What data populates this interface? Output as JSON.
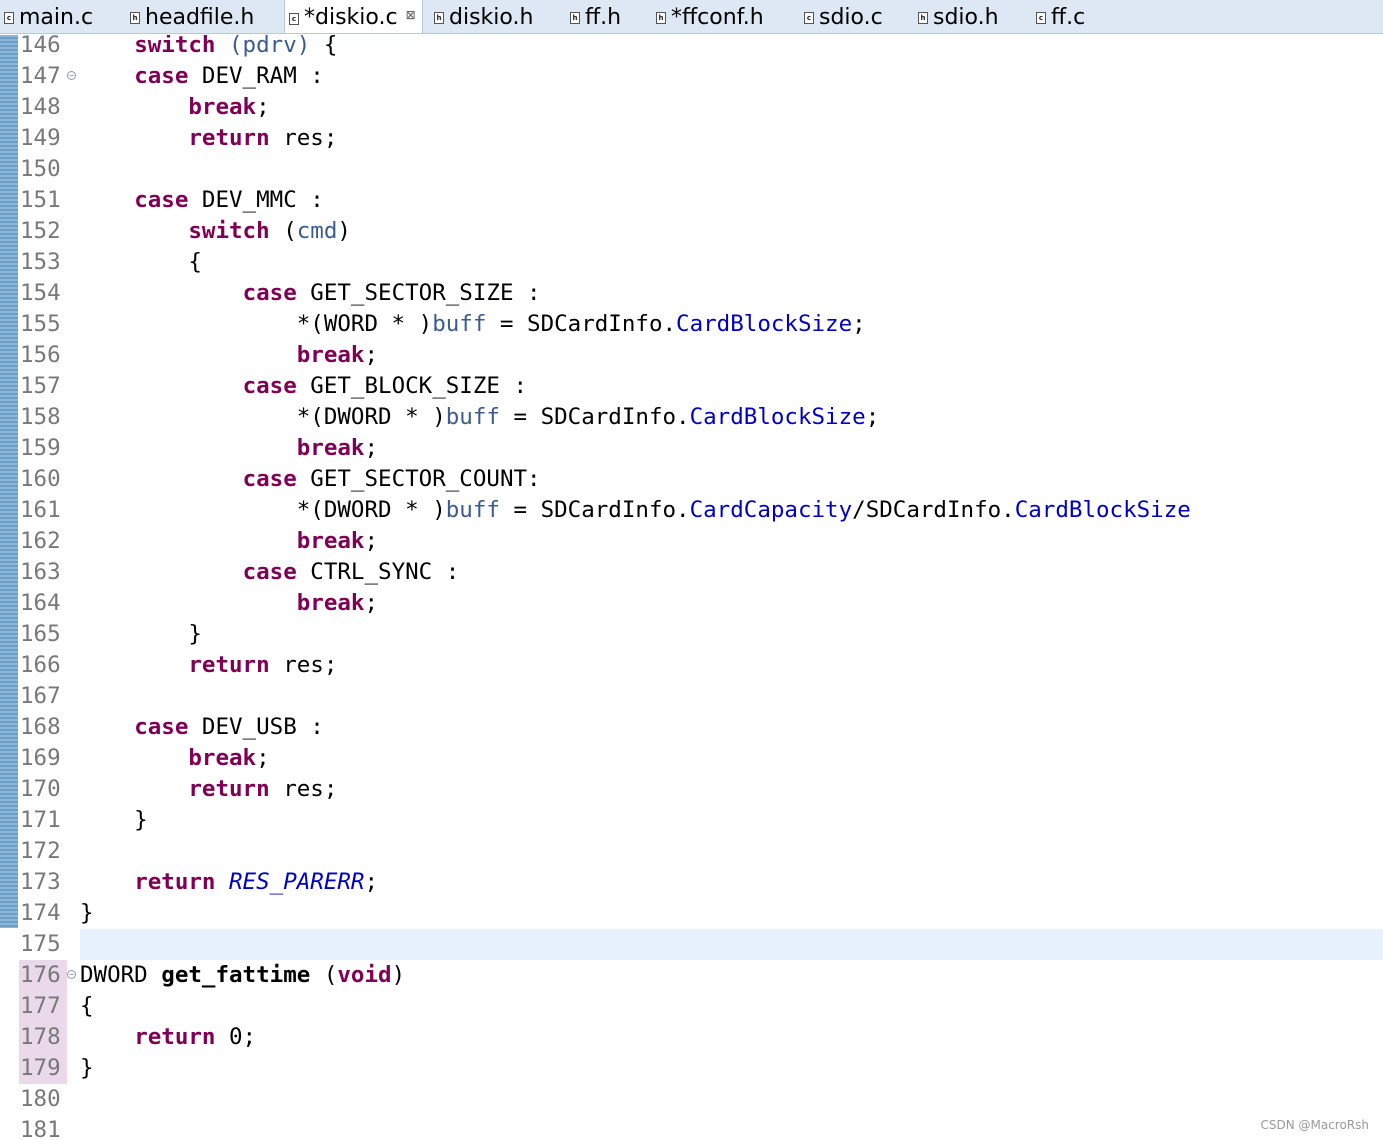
{
  "tabs": [
    {
      "label": "main.c",
      "icon": "c-file-icon",
      "active": false
    },
    {
      "label": "headfile.h",
      "icon": "h-file-icon",
      "active": false
    },
    {
      "label": "*diskio.c",
      "icon": "c-file-icon",
      "active": true,
      "close": "⊠"
    },
    {
      "label": "diskio.h",
      "icon": "h-file-icon",
      "active": false
    },
    {
      "label": "ff.h",
      "icon": "h-file-icon",
      "active": false
    },
    {
      "label": "*ffconf.h",
      "icon": "h-file-icon",
      "active": false
    },
    {
      "label": "sdio.c",
      "icon": "c-file-icon",
      "active": false
    },
    {
      "label": "sdio.h",
      "icon": "h-file-icon",
      "active": false
    },
    {
      "label": "ff.c",
      "icon": "c-file-icon",
      "active": false
    }
  ],
  "editor": {
    "lines": [
      {
        "n": "146",
        "tokens": [
          [
            "    ",
            ""
          ],
          [
            "switch",
            "kw"
          ],
          [
            " ",
            ""
          ],
          [
            "(pdrv)",
            "param"
          ],
          [
            " {",
            ""
          ]
        ]
      },
      {
        "n": "147",
        "fold": true,
        "tokens": [
          [
            "    ",
            ""
          ],
          [
            "case",
            "kw"
          ],
          [
            " DEV_RAM :",
            ""
          ]
        ]
      },
      {
        "n": "148",
        "tokens": [
          [
            "        ",
            ""
          ],
          [
            "break",
            "kw"
          ],
          [
            ";",
            ""
          ]
        ]
      },
      {
        "n": "149",
        "tokens": [
          [
            "        ",
            ""
          ],
          [
            "return",
            "kw"
          ],
          [
            " res;",
            ""
          ]
        ]
      },
      {
        "n": "150",
        "tokens": []
      },
      {
        "n": "151",
        "tokens": [
          [
            "    ",
            ""
          ],
          [
            "case",
            "kw"
          ],
          [
            " DEV_MMC :",
            ""
          ]
        ]
      },
      {
        "n": "152",
        "tokens": [
          [
            "        ",
            ""
          ],
          [
            "switch",
            "kw"
          ],
          [
            " (",
            ""
          ],
          [
            "cmd",
            "param"
          ],
          [
            ")",
            ""
          ]
        ]
      },
      {
        "n": "153",
        "tokens": [
          [
            "        {",
            ""
          ]
        ]
      },
      {
        "n": "154",
        "tokens": [
          [
            "            ",
            ""
          ],
          [
            "case",
            "kw"
          ],
          [
            " GET_SECTOR_SIZE :",
            ""
          ]
        ]
      },
      {
        "n": "155",
        "tokens": [
          [
            "                *(WORD * )",
            ""
          ],
          [
            "buff",
            "param"
          ],
          [
            " = SDCardInfo.",
            ""
          ],
          [
            "CardBlockSize",
            "field"
          ],
          [
            ";",
            ""
          ]
        ]
      },
      {
        "n": "156",
        "tokens": [
          [
            "                ",
            ""
          ],
          [
            "break",
            "kw"
          ],
          [
            ";",
            ""
          ]
        ]
      },
      {
        "n": "157",
        "tokens": [
          [
            "            ",
            ""
          ],
          [
            "case",
            "kw"
          ],
          [
            " GET_BLOCK_SIZE :",
            ""
          ]
        ]
      },
      {
        "n": "158",
        "tokens": [
          [
            "                *(DWORD * )",
            ""
          ],
          [
            "buff",
            "param"
          ],
          [
            " = SDCardInfo.",
            ""
          ],
          [
            "CardBlockSize",
            "field"
          ],
          [
            ";",
            ""
          ]
        ]
      },
      {
        "n": "159",
        "tokens": [
          [
            "                ",
            ""
          ],
          [
            "break",
            "kw"
          ],
          [
            ";",
            ""
          ]
        ]
      },
      {
        "n": "160",
        "tokens": [
          [
            "            ",
            ""
          ],
          [
            "case",
            "kw"
          ],
          [
            " GET_SECTOR_COUNT:",
            ""
          ]
        ]
      },
      {
        "n": "161",
        "tokens": [
          [
            "                *(DWORD * )",
            ""
          ],
          [
            "buff",
            "param"
          ],
          [
            " = SDCardInfo.",
            ""
          ],
          [
            "CardCapacity",
            "field"
          ],
          [
            "/SDCardInfo.",
            ""
          ],
          [
            "CardBlockSize",
            "field"
          ]
        ]
      },
      {
        "n": "162",
        "tokens": [
          [
            "                ",
            ""
          ],
          [
            "break",
            "kw"
          ],
          [
            ";",
            ""
          ]
        ]
      },
      {
        "n": "163",
        "tokens": [
          [
            "            ",
            ""
          ],
          [
            "case",
            "kw"
          ],
          [
            " CTRL_SYNC :",
            ""
          ]
        ]
      },
      {
        "n": "164",
        "tokens": [
          [
            "                ",
            ""
          ],
          [
            "break",
            "kw"
          ],
          [
            ";",
            ""
          ]
        ]
      },
      {
        "n": "165",
        "tokens": [
          [
            "        }",
            ""
          ]
        ]
      },
      {
        "n": "166",
        "tokens": [
          [
            "        ",
            ""
          ],
          [
            "return",
            "kw"
          ],
          [
            " res;",
            ""
          ]
        ]
      },
      {
        "n": "167",
        "tokens": []
      },
      {
        "n": "168",
        "tokens": [
          [
            "    ",
            ""
          ],
          [
            "case",
            "kw"
          ],
          [
            " DEV_USB :",
            ""
          ]
        ]
      },
      {
        "n": "169",
        "tokens": [
          [
            "        ",
            ""
          ],
          [
            "break",
            "kw"
          ],
          [
            ";",
            ""
          ]
        ]
      },
      {
        "n": "170",
        "tokens": [
          [
            "        ",
            ""
          ],
          [
            "return",
            "kw"
          ],
          [
            " res;",
            ""
          ]
        ]
      },
      {
        "n": "171",
        "tokens": [
          [
            "    }",
            ""
          ]
        ]
      },
      {
        "n": "172",
        "tokens": []
      },
      {
        "n": "173",
        "tokens": [
          [
            "    ",
            ""
          ],
          [
            "return",
            "kw"
          ],
          [
            " ",
            ""
          ],
          [
            "RES_PARERR",
            "macro"
          ],
          [
            ";",
            ""
          ]
        ]
      },
      {
        "n": "174",
        "tokens": [
          [
            "}",
            ""
          ]
        ]
      },
      {
        "n": "175",
        "current": true,
        "tokens": []
      },
      {
        "n": "176",
        "fold": true,
        "block": true,
        "tokens": [
          [
            "DWORD ",
            ""
          ],
          [
            "get_fattime",
            "fn"
          ],
          [
            " (",
            ""
          ],
          [
            "void",
            "kw"
          ],
          [
            ")",
            ""
          ]
        ]
      },
      {
        "n": "177",
        "block": true,
        "tokens": [
          [
            "{",
            ""
          ]
        ]
      },
      {
        "n": "178",
        "block": true,
        "tokens": [
          [
            "    ",
            ""
          ],
          [
            "return",
            "kw"
          ],
          [
            " 0;",
            ""
          ]
        ]
      },
      {
        "n": "179",
        "block": true,
        "tokens": [
          [
            "}",
            ""
          ]
        ]
      },
      {
        "n": "180",
        "tokens": []
      },
      {
        "n": "181",
        "tokens": []
      }
    ]
  },
  "watermark": "CSDN @MacroRsh",
  "colors": {
    "keyword": "#7f0055",
    "field": "#0000c0",
    "parameter": "#3b5b92",
    "line_number": "#787878",
    "current_line": "#e8f2fe",
    "tab_bar": "#dde8f4"
  }
}
